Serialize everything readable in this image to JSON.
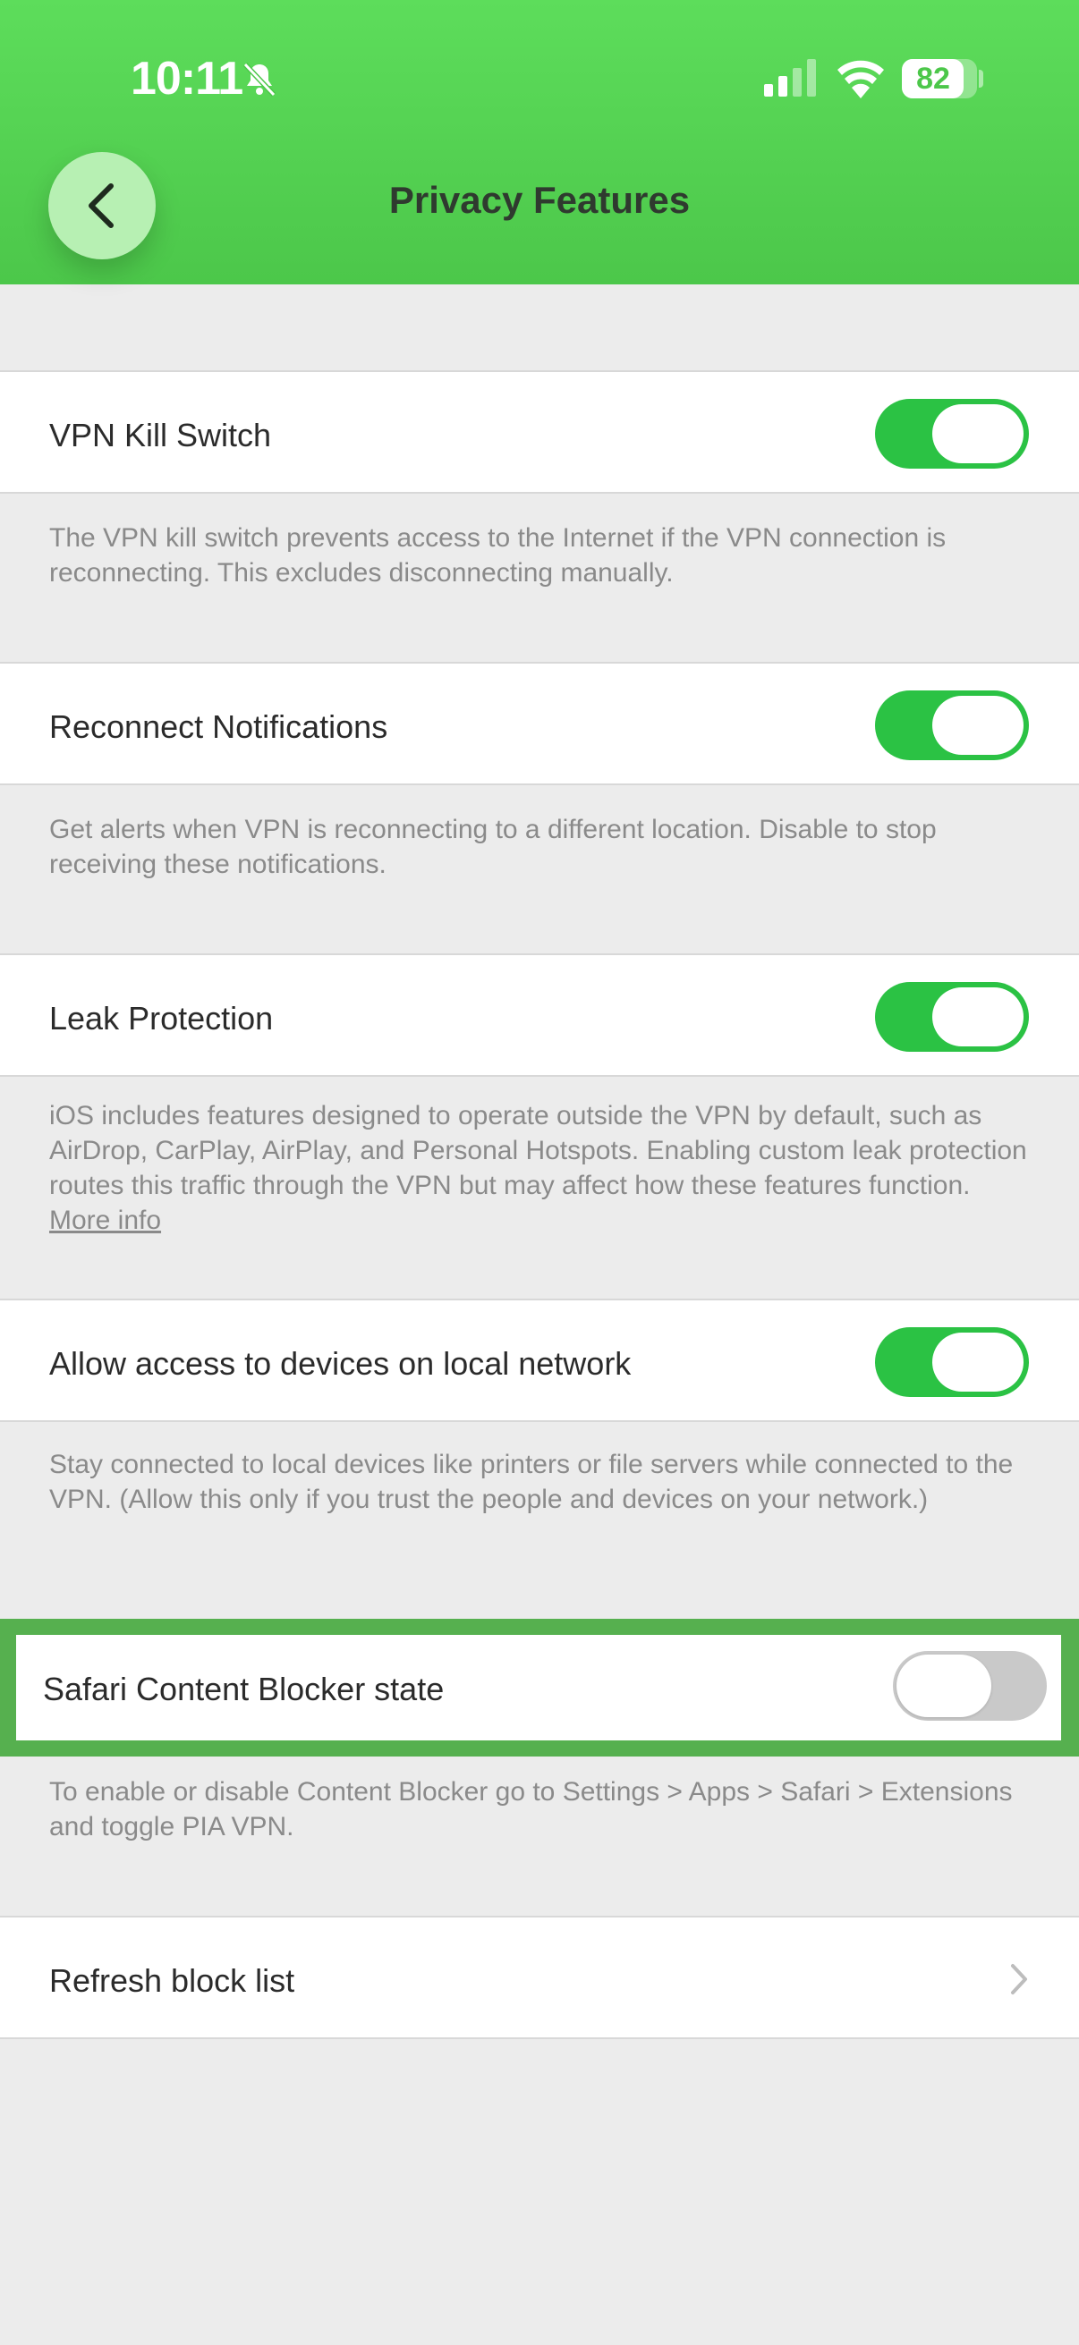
{
  "status_bar": {
    "time": "10:11",
    "battery": "82",
    "battery_level": 0.82,
    "icons": [
      "bell-slash-icon",
      "signal-icon",
      "wifi-icon",
      "battery-icon"
    ]
  },
  "nav": {
    "title": "Privacy Features",
    "back_icon": "chevron-left-icon"
  },
  "settings": [
    {
      "label": "VPN Kill Switch",
      "enabled": true,
      "description": "The VPN kill switch prevents access to the Internet if the VPN connection is reconnecting. This excludes disconnecting manually."
    },
    {
      "label": "Reconnect Notifications",
      "enabled": true,
      "description": "Get alerts when VPN is reconnecting to a different location. Disable to stop receiving these notifications."
    },
    {
      "label": "Leak Protection",
      "enabled": true,
      "description": "iOS includes features designed to operate outside the VPN by default, such as AirDrop, CarPlay, AirPlay, and Personal Hotspots. Enabling custom leak protection routes this traffic through the VPN but may affect how these features function.",
      "link": "More info"
    },
    {
      "label": "Allow access to devices on local network",
      "enabled": true,
      "description": "Stay connected to local devices like printers or file servers while connected to the VPN. (Allow this only if you trust the people and devices on your network.)"
    },
    {
      "label": "Safari Content Blocker state",
      "enabled": false,
      "description": "To enable or disable Content Blocker go to Settings > Apps > Safari > Extensions and toggle PIA VPN."
    }
  ],
  "refresh": {
    "label": "Refresh block list",
    "icon": "chevron-right-icon"
  },
  "colors": {
    "header_green": "#4cc74a",
    "toggle_on": "#2bc244",
    "highlight_border": "#56b04f"
  }
}
